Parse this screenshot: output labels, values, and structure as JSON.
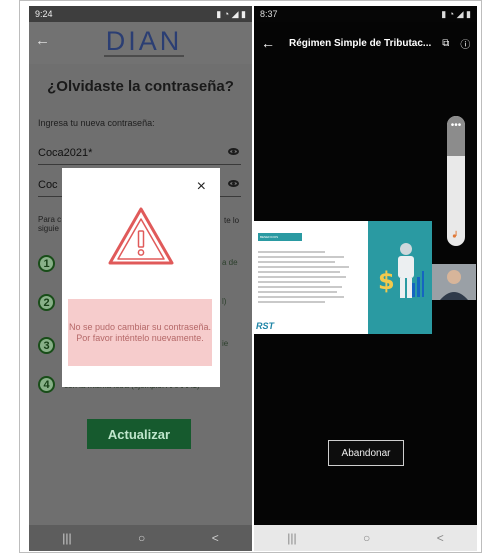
{
  "left_phone": {
    "status": {
      "time": "9:24"
    },
    "logo_text": "DIAN",
    "title": "¿Olvidaste la contraseña?",
    "prompt": "Ingresa tu nueva contraseña:",
    "password_field": "Coca2021*",
    "confirm_field_partial": "Coc",
    "note_left_partial": "Para c",
    "note_left_partial2": "siguie",
    "note_right_partial": "te lo",
    "steps": [
      "1",
      "2",
      "3",
      "4"
    ],
    "step_tails": [
      "a de",
      "l)",
      "ie"
    ],
    "step4_text": "con la misma letra (ejemplo: AAAAA1)",
    "button_label": "Actualizar",
    "modal": {
      "close": "×",
      "error_message": "No se pudo cambiar su contraseña. Por favor inténtelo nuevamente."
    },
    "nav": [
      "|||",
      "○",
      "<"
    ]
  },
  "right_phone": {
    "status": {
      "time": "8:37"
    },
    "title": "Régimen Simple de Tributac...",
    "volume_menu": "•••",
    "slide": {
      "heading": "BENEFICIOS",
      "logo": "RST"
    },
    "button_label": "Abandonar",
    "nav": [
      "|||",
      "○",
      "<"
    ]
  }
}
